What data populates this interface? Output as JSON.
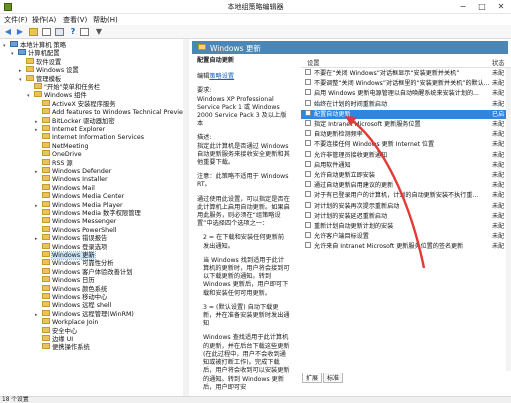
{
  "window": {
    "title": "本地组策略编辑器",
    "minimize": "−",
    "maximize": "□",
    "close": "✕"
  },
  "menu": [
    "文件(F)",
    "操作(A)",
    "查看(V)",
    "帮助(H)"
  ],
  "toolbar_icons": [
    "back-arrow-icon",
    "forward-arrow-icon",
    "folder-up-icon",
    "show-hide-tree-icon",
    "export-list-icon",
    "help-icon",
    "properties-icon",
    "filter-icon"
  ],
  "tree": [
    {
      "label": "本地计算机 策略",
      "level": 0,
      "kind": "pc",
      "exp": "▾"
    },
    {
      "label": "计算机配置",
      "level": 1,
      "kind": "pc",
      "exp": "▾"
    },
    {
      "label": "软件设置",
      "level": 2,
      "kind": "folder",
      "exp": ""
    },
    {
      "label": "Windows 设置",
      "level": 2,
      "kind": "folder",
      "exp": "▸"
    },
    {
      "label": "管理模板",
      "level": 2,
      "kind": "folder",
      "exp": "▾"
    },
    {
      "label": "\"开始\"菜单和任务栏",
      "level": 3,
      "kind": "folder",
      "exp": ""
    },
    {
      "label": "Windows 组件",
      "level": 3,
      "kind": "folder",
      "exp": "▾"
    },
    {
      "label": "ActiveX 安装程序服务",
      "level": 4,
      "kind": "folder",
      "exp": ""
    },
    {
      "label": "Add features to Windows Technical Preview",
      "level": 4,
      "kind": "folder",
      "exp": ""
    },
    {
      "label": "BitLocker 驱动器加密",
      "level": 4,
      "kind": "folder",
      "exp": "▸"
    },
    {
      "label": "Internet Explorer",
      "level": 4,
      "kind": "folder",
      "exp": "▸"
    },
    {
      "label": "Internet Information Services",
      "level": 4,
      "kind": "folder",
      "exp": ""
    },
    {
      "label": "NetMeeting",
      "level": 4,
      "kind": "folder",
      "exp": ""
    },
    {
      "label": "OneDrive",
      "level": 4,
      "kind": "folder",
      "exp": ""
    },
    {
      "label": "RSS 源",
      "level": 4,
      "kind": "folder",
      "exp": ""
    },
    {
      "label": "Windows Defender",
      "level": 4,
      "kind": "folder",
      "exp": "▸"
    },
    {
      "label": "Windows Installer",
      "level": 4,
      "kind": "folder",
      "exp": ""
    },
    {
      "label": "Windows Mail",
      "level": 4,
      "kind": "folder",
      "exp": ""
    },
    {
      "label": "Windows Media Center",
      "level": 4,
      "kind": "folder",
      "exp": ""
    },
    {
      "label": "Windows Media Player",
      "level": 4,
      "kind": "folder",
      "exp": "▸"
    },
    {
      "label": "Windows Media 数字权限管理",
      "level": 4,
      "kind": "folder",
      "exp": ""
    },
    {
      "label": "Windows Messenger",
      "level": 4,
      "kind": "folder",
      "exp": ""
    },
    {
      "label": "Windows PowerShell",
      "level": 4,
      "kind": "folder",
      "exp": ""
    },
    {
      "label": "Windows 错误报告",
      "level": 4,
      "kind": "folder",
      "exp": "▸"
    },
    {
      "label": "Windows 登录选项",
      "level": 4,
      "kind": "folder",
      "exp": ""
    },
    {
      "label": "Windows 更新",
      "level": 4,
      "kind": "folder",
      "exp": "",
      "selected": true
    },
    {
      "label": "Windows 可靠性分析",
      "level": 4,
      "kind": "folder",
      "exp": ""
    },
    {
      "label": "Windows 客户体验改善计划",
      "level": 4,
      "kind": "folder",
      "exp": ""
    },
    {
      "label": "Windows 日历",
      "level": 4,
      "kind": "folder",
      "exp": ""
    },
    {
      "label": "Windows 颜色系统",
      "level": 4,
      "kind": "folder",
      "exp": ""
    },
    {
      "label": "Windows 移动中心",
      "level": 4,
      "kind": "folder",
      "exp": ""
    },
    {
      "label": "Windows 远程 shell",
      "level": 4,
      "kind": "folder",
      "exp": ""
    },
    {
      "label": "Windows 远程管理(WinRM)",
      "level": 4,
      "kind": "folder",
      "exp": "▸"
    },
    {
      "label": "Workplace Join",
      "level": 4,
      "kind": "folder",
      "exp": ""
    },
    {
      "label": "安全中心",
      "level": 4,
      "kind": "folder",
      "exp": ""
    },
    {
      "label": "边缘 UI",
      "level": 4,
      "kind": "folder",
      "exp": ""
    },
    {
      "label": "便携操作系统",
      "level": 4,
      "kind": "folder",
      "exp": ""
    }
  ],
  "right": {
    "header": "Windows 更新",
    "description": {
      "title": "配置自动更新",
      "edit_prefix": "编辑",
      "edit_link": "策略设置",
      "paragraphs": [
        "要求:\nWindows XP Professional Service Pack 1 或 Windows 2000 Service Pack 3 及以上版本",
        "描述:\n指定此计算机是否通过 Windows 自动更新服务来接收安全更新和其他重要下载。",
        "注意：此策略不适用于 Windows RT。",
        "通过使用此设置，可以指定是否在此计算机上启用自动更新。如果启用此服务，则必须在“组策略设置”中选择四个选项之一：",
        "2 = 在下载和安装任何更新前发出通知。",
        "当 Windows 找到适用于此计算机的更新时，用户将会接到可以下载更新的通知。转到 Windows 更新后，用户即可下载和安装任何可用更新。",
        "3 = (默认设置) 自动下载更新，并在准备安装更新时发出通知",
        "Windows 查找适用于此计算机的更新，并在后台下载这些更新(在此过程中，用户不会收到通知或被打断工作)。完成下载后，用户将会收到可以安装更新的通知。转到 Windows 更新后，用户即可安"
      ]
    },
    "col_setting": "设置",
    "col_state": "状态",
    "settings": [
      {
        "text": "不要在“关闭 Windows”对话框显示“安装更新并关机”",
        "state": "未配"
      },
      {
        "text": "不要调整“关闭 Windows”对话框里的“安装更新并关机”的默认...",
        "state": "未配"
      },
      {
        "text": "启用 Windows 更新电源管理以自动唤醒系统来安装计划的...",
        "state": "未配"
      },
      {
        "text": "始终在计划的时间重新启动",
        "state": "未配"
      },
      {
        "text": "配置自动更新",
        "state": "已启",
        "selected": true
      },
      {
        "text": "指定 Intranet Microsoft 更新服务位置",
        "state": "未配"
      },
      {
        "text": "自动更新检测频率",
        "state": "未配"
      },
      {
        "text": "不要连接任何 Windows 更新 Internet 位置",
        "state": "未配"
      },
      {
        "text": "允许非管理员接收更新通知",
        "state": "未配"
      },
      {
        "text": "启用软件通知",
        "state": "未配"
      },
      {
        "text": "允许自动更新立即安装",
        "state": "未配"
      },
      {
        "text": "通过自动更新启用建议的更新",
        "state": "未配"
      },
      {
        "text": "对于有已登录用户的计算机，计划的自动更新安装不执行重...",
        "state": "未配"
      },
      {
        "text": "对计划的安装再次提示重新启动",
        "state": "未配"
      },
      {
        "text": "对计划的安装延迟重新启动",
        "state": "未配"
      },
      {
        "text": "重新计划自动更新计划的安装",
        "state": "未配"
      },
      {
        "text": "允许客户端目标设置",
        "state": "未配"
      },
      {
        "text": "允许来自 Intranet Microsoft 更新服务位置的签名更新",
        "state": "未配"
      }
    ],
    "tabs": [
      "扩展",
      "标准"
    ]
  },
  "status": "18 个设置",
  "colors": {
    "header_band": "#4b86b4",
    "selected_row": "#2f86e0",
    "arrow": "#e53935"
  }
}
